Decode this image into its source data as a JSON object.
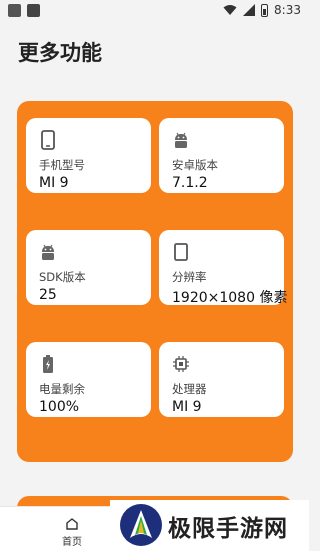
{
  "status_bar": {
    "time": "8:33"
  },
  "page": {
    "title": "更多功能"
  },
  "cards": [
    {
      "icon": "phone-icon",
      "label": "手机型号",
      "value": "MI 9"
    },
    {
      "icon": "android-icon",
      "label": "安卓版本",
      "value": "7.1.2"
    },
    {
      "icon": "android-icon",
      "label": "SDK版本",
      "value": "25"
    },
    {
      "icon": "screen-icon",
      "label": "分辨率",
      "value": "1920×1080 像素"
    },
    {
      "icon": "battery-icon",
      "label": "电量剩余",
      "value": "100%"
    },
    {
      "icon": "cpu-icon",
      "label": "处理器",
      "value": "MI 9"
    }
  ],
  "bottom_nav": {
    "home_label": "首页"
  },
  "watermark": {
    "text": "极限手游网"
  },
  "colors": {
    "accent": "#f7821b",
    "card": "#ffffff",
    "background": "#f3f3f3"
  }
}
